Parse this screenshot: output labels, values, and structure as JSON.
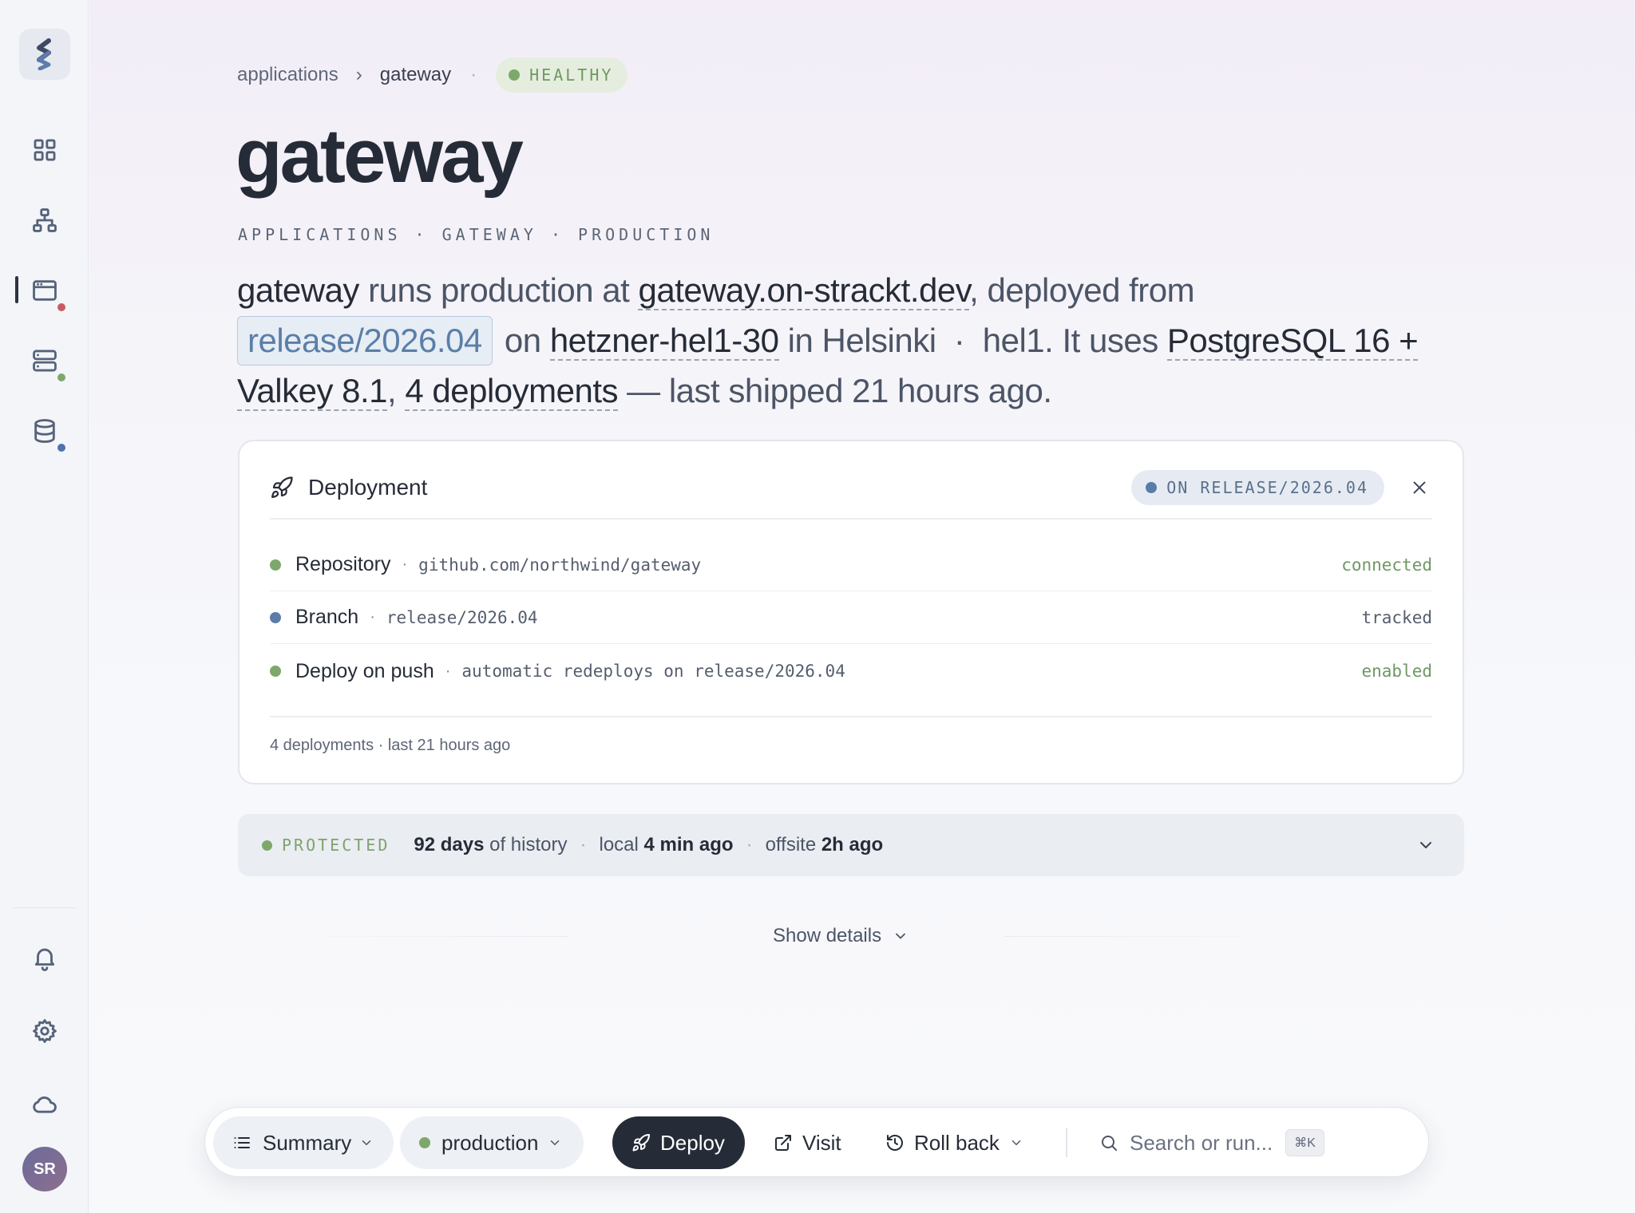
{
  "sidebar": {
    "avatar_initials": "SR",
    "status_colors": {
      "red": "#c65b63",
      "green": "#7ea76c",
      "blue": "#4f73ab"
    }
  },
  "breadcrumb": {
    "root": "applications",
    "current": "gateway",
    "sep": "›",
    "dot": "·",
    "status": "HEALTHY"
  },
  "page": {
    "title": "gateway",
    "subtitle": "APPLICATIONS · GATEWAY · PRODUCTION"
  },
  "summary": {
    "name": "gateway",
    "t1": " runs production at ",
    "domain": "gateway.on-strackt.dev",
    "t2": ", deployed from",
    "branch": "release/2026.04",
    "t3": " on ",
    "server": "hetzner-hel1-30",
    "t4": " in Helsinki  ·  hel1. It uses ",
    "db": "PostgreSQL 16 + Valkey 8.1",
    "t5": ", ",
    "deployments": "4 deployments",
    "t6": " — last shipped 21 hours ago."
  },
  "deployment": {
    "title": "Deployment",
    "pill": "ON RELEASE/2026.04",
    "sep": "·",
    "rows": [
      {
        "label": "Repository",
        "detail": "github.com/northwind/gateway",
        "state": "connected",
        "dot": "#7ea76c",
        "state_color": "#6f9863"
      },
      {
        "label": "Branch",
        "detail": "release/2026.04",
        "state": "tracked",
        "dot": "#5a7cab",
        "state_color": "#555e6e"
      },
      {
        "label": "Deploy on push",
        "detail": "automatic redeploys on release/2026.04",
        "state": "enabled",
        "dot": "#7ea76c",
        "state_color": "#6f9863"
      }
    ],
    "footer": "4 deployments · last 21 hours ago"
  },
  "protected": {
    "tag": "PROTECTED",
    "days": "92 days",
    "history": " of history",
    "dot": "·",
    "local_label": "local ",
    "local_value": "4 min ago",
    "offsite_label": "offsite ",
    "offsite_value": "2h ago"
  },
  "show_details": "Show details",
  "toolbar": {
    "summary": "Summary",
    "env": "production",
    "deploy": "Deploy",
    "visit": "Visit",
    "rollback": "Roll back",
    "search_placeholder": "Search or run...",
    "shortcut": "⌘K"
  }
}
